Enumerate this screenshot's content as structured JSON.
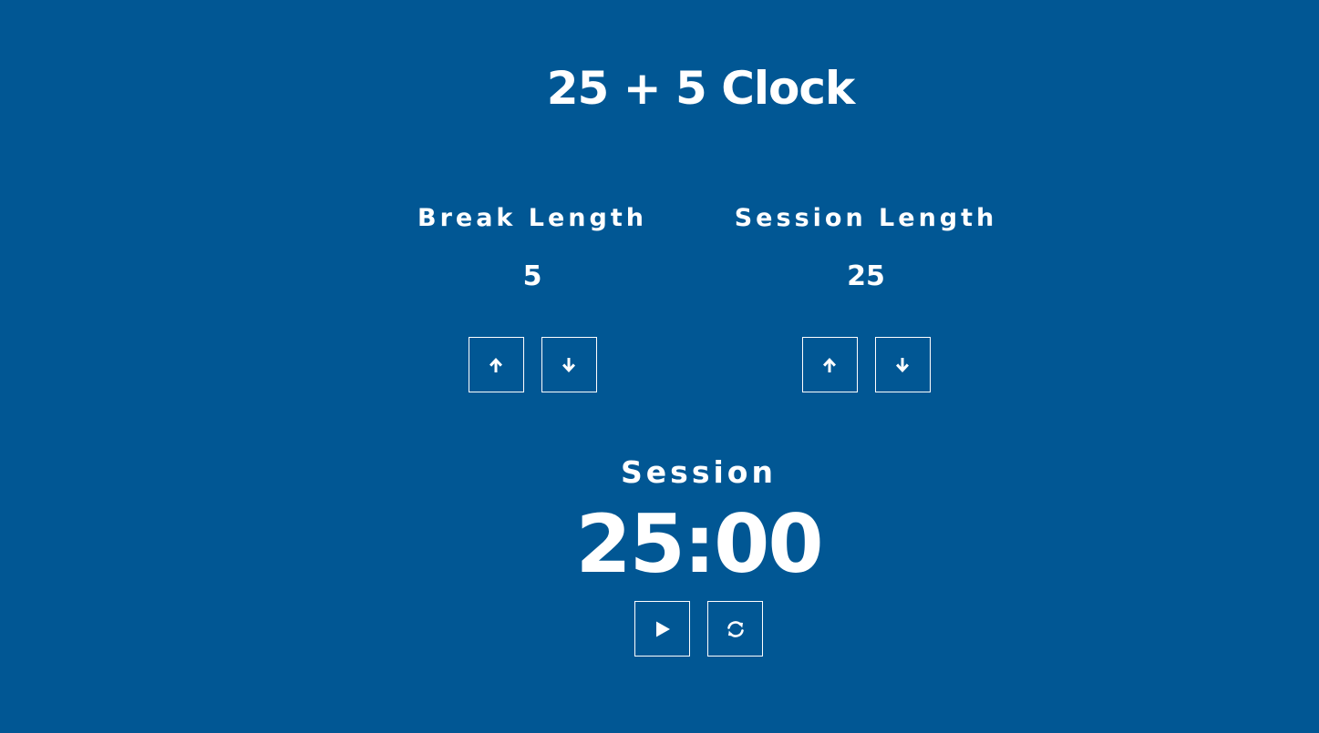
{
  "app": {
    "title": "25 + 5 Clock"
  },
  "break": {
    "label": "Break Length",
    "value": "5",
    "increment_icon": "arrow-up-icon",
    "decrement_icon": "arrow-down-icon"
  },
  "session": {
    "label": "Session Length",
    "value": "25",
    "increment_icon": "arrow-up-icon",
    "decrement_icon": "arrow-down-icon"
  },
  "timer": {
    "label": "Session",
    "time_left": "25:00",
    "start_stop_icon": "play-icon",
    "reset_icon": "refresh-icon"
  },
  "colors": {
    "background": "#015794",
    "foreground": "#ffffff"
  }
}
